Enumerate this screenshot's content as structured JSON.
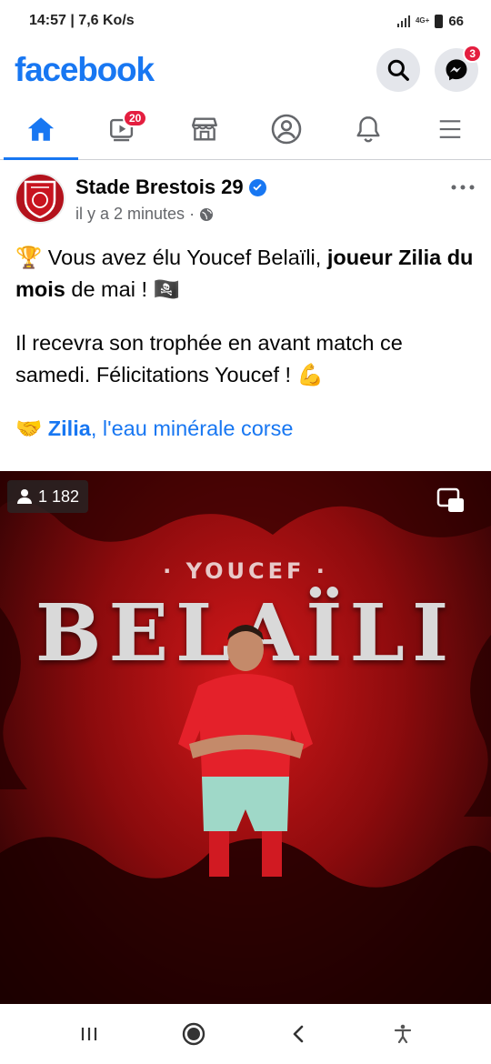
{
  "status_bar": {
    "time": "14:57",
    "speed": "7,6 Ko/s",
    "network": "4G+",
    "battery": "66"
  },
  "header": {
    "logo": "facebook",
    "messenger_badge": "3"
  },
  "tabs": {
    "video_badge": "20"
  },
  "post": {
    "page_name": "Stade Brestois 29",
    "time": "il y a 2 minutes",
    "line1_prefix": "Vous avez élu Youcef Belaïli, ",
    "line1_bold": "joueur Zilia du mois",
    "line1_suffix": " de mai ! ",
    "line2": "Il recevra son trophée en avant match ce samedi.  Félicitations Youcef ! ",
    "sponsor_bold": "Zilia",
    "sponsor_rest": ", l'eau minérale corse"
  },
  "media": {
    "viewers": "1 182",
    "first_name": "· YOUCEF ·",
    "last_name": "BELAÏLI"
  },
  "colors": {
    "brand": "#1877f2",
    "badge": "#e41e3f",
    "club_red": "#b3121c"
  }
}
